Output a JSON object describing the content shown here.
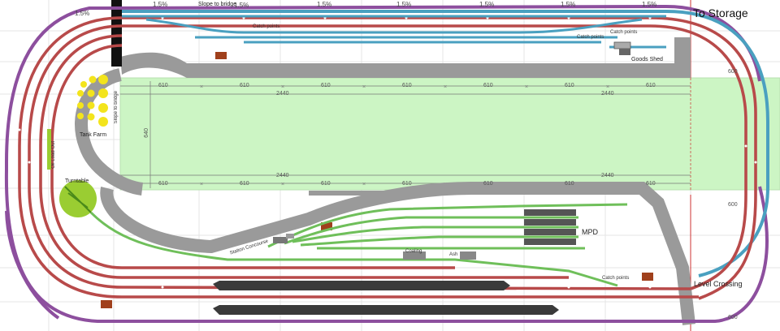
{
  "labels": {
    "to_storage": "To Storage",
    "level_crossing": "Level Crossing",
    "goods_shed": "Goods Shed",
    "tank_farm": "Tank Farm",
    "turntable": "Turntable",
    "oil_load_out": "Oil Load Out",
    "slope_to_bridge": "Slope to bridge",
    "station_concourse": "Station Concourse",
    "mpd": "MPD",
    "catch_points": "Catch points",
    "slope_to_bridge_top": "Slope to bridge",
    "coaling": "Coaling",
    "ash": "Ash"
  },
  "gradients": [
    "1.5%",
    "1.5%",
    "1.5%",
    "1.5%",
    "1.5%",
    "1.5%",
    "1.5%",
    "1.5%"
  ],
  "dimensions": {
    "segment": "610",
    "total": "2440",
    "side": "600",
    "depth": "640"
  },
  "colors": {
    "baseboard": "#ccf5c4",
    "mainline_red": "#b84a4a",
    "outer_purple": "#8d4f9e",
    "blue_yard": "#4aa0c0",
    "green_yard": "#6fbf5a",
    "platform_dark": "#3a3a3a",
    "roadway_grey": "#9a9a9a",
    "turntable": "#9acd32",
    "tank_yellow": "#f3e41c"
  }
}
